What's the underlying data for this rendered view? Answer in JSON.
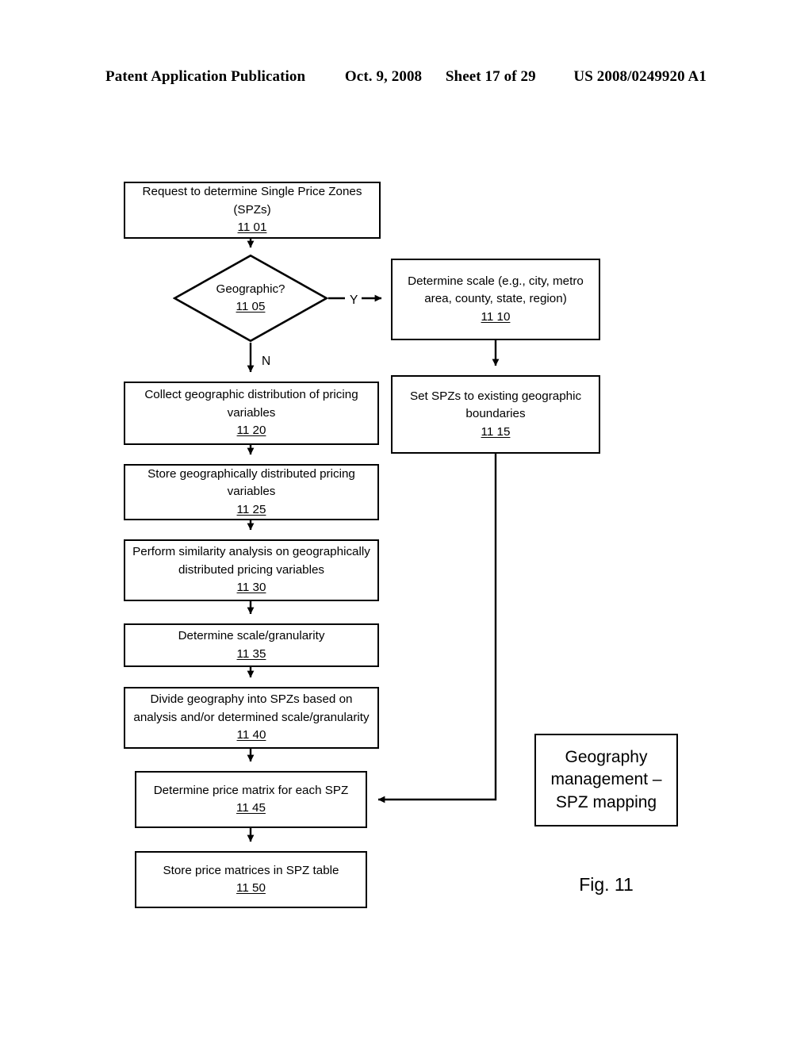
{
  "header": {
    "publication": "Patent Application Publication",
    "date": "Oct. 9, 2008",
    "sheet": "Sheet 17 of 29",
    "patent_number": "US 2008/0249920 A1"
  },
  "figure": {
    "caption": "Fig. 11",
    "legend_line1": "Geography",
    "legend_line2": "management –",
    "legend_line3": "SPZ mapping"
  },
  "flowchart": {
    "nodes": {
      "n1101": {
        "line1": "Request to determine Single Price Zones",
        "line2": "(SPZs)",
        "ref": "11 01"
      },
      "n1105": {
        "line1": "Geographic?",
        "ref": "11 05"
      },
      "n1110": {
        "line1": "Determine scale (e.g., city, metro",
        "line2": "area, county, state, region)",
        "ref": "11 10"
      },
      "n1115": {
        "line1": "Set SPZs to existing geographic",
        "line2": "boundaries",
        "ref": "11 15"
      },
      "n1120": {
        "line1": "Collect geographic distribution of pricing",
        "line2": "variables",
        "ref": "11 20"
      },
      "n1125": {
        "line1": "Store geographically distributed pricing",
        "line2": "variables",
        "ref": "11 25"
      },
      "n1130": {
        "line1": "Perform similarity analysis on geographically",
        "line2": "distributed pricing variables",
        "ref": "11 30"
      },
      "n1135": {
        "line1": "Determine scale/granularity",
        "ref": "11 35"
      },
      "n1140": {
        "line1": "Divide geography into SPZs based on",
        "line2": "analysis and/or determined scale/granularity",
        "ref": "11 40"
      },
      "n1145": {
        "line1": "Determine price matrix for each SPZ",
        "ref": "11 45"
      },
      "n1150": {
        "line1": "Store price matrices in SPZ table",
        "ref": "11 50"
      }
    },
    "branches": {
      "yes": "Y",
      "no": "N"
    }
  },
  "colors": {
    "ink": "#000000",
    "paper": "#ffffff"
  }
}
